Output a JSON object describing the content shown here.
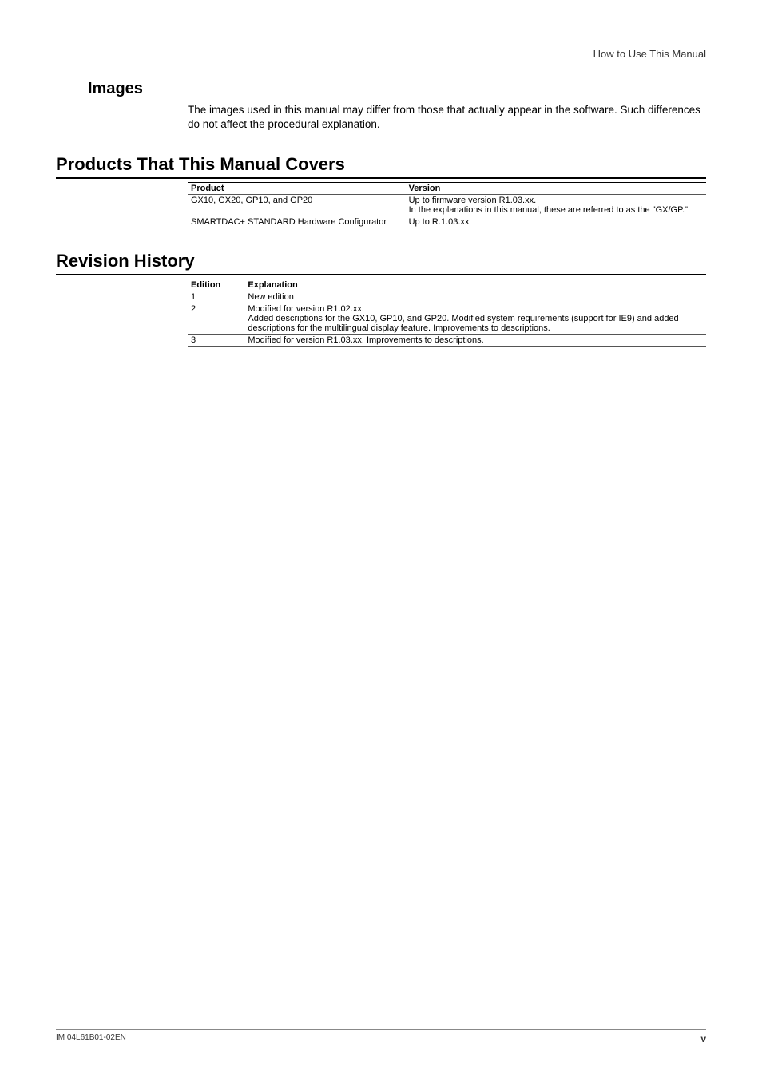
{
  "running_header": "How to Use This Manual",
  "images": {
    "heading": "Images",
    "body": "The images used in this manual may differ from those that actually appear in the software. Such differences do not affect the procedural explanation."
  },
  "products_section": {
    "heading": "Products That This Manual Covers",
    "headers": {
      "product": "Product",
      "version": "Version"
    },
    "rows": [
      {
        "product": "GX10, GX20, GP10, and GP20",
        "version": "Up to firmware version R1.03.xx.\nIn the explanations in this manual, these are referred to as the \"GX/GP.\""
      },
      {
        "product": "SMARTDAC+ STANDARD Hardware Configurator",
        "version": "Up to R.1.03.xx"
      }
    ]
  },
  "revision_section": {
    "heading": "Revision History",
    "headers": {
      "edition": "Edition",
      "explanation": "Explanation"
    },
    "rows": [
      {
        "edition": "1",
        "explanation": "New edition"
      },
      {
        "edition": "2",
        "explanation": "Modified for version R1.02.xx.\nAdded descriptions for the GX10, GP10, and GP20. Modified system requirements (support for IE9) and added descriptions for the multilingual display feature. Improvements to descriptions."
      },
      {
        "edition": "3",
        "explanation": "Modified for version R1.03.xx. Improvements to descriptions."
      }
    ]
  },
  "footer": {
    "docid": "IM 04L61B01-02EN",
    "pagenum": "v"
  }
}
